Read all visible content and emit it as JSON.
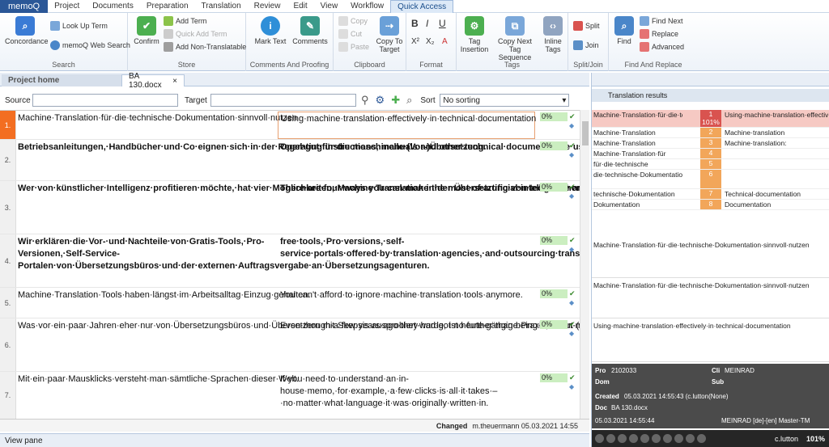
{
  "menubar": {
    "app": "memoQ",
    "tabs": [
      "Project",
      "Documents",
      "Preparation",
      "Translation",
      "Review",
      "Edit",
      "View",
      "Workflow",
      "Quick Access"
    ]
  },
  "ribbon": {
    "search": {
      "title": "Search",
      "concordance": "Concordance",
      "look_up_term": "Look Up Term",
      "web_search": "memoQ Web Search"
    },
    "store": {
      "title": "Store",
      "confirm": "Confirm",
      "add_term": "Add Term",
      "quick_add_term": "Quick Add Term",
      "add_non_translatable": "Add Non-Translatable"
    },
    "comments": {
      "title": "Comments And Proofing",
      "mark_text": "Mark Text",
      "comments": "Comments"
    },
    "clipboard": {
      "title": "Clipboard",
      "copy": "Copy",
      "cut": "Cut",
      "paste": "Paste",
      "copy_to_target": "Copy To Target"
    },
    "format": {
      "title": "Format",
      "bold": "B",
      "italic": "I",
      "underline": "U",
      "sup": "X²",
      "sub": "X₂",
      "clear": "A"
    },
    "tags": {
      "title": "Tags",
      "tag_insertion": "Tag Insertion",
      "copy_next": "Copy Next Tag Sequence",
      "inline_tags": "Inline Tags"
    },
    "splitjoin": {
      "title": "Split/Join",
      "split": "Split",
      "join": "Join"
    },
    "find": {
      "title": "Find And Replace",
      "find": "Find",
      "find_next": "Find Next",
      "replace": "Replace",
      "advanced": "Advanced"
    }
  },
  "tabs": {
    "home": "Project home",
    "doc": "BA 130.docx"
  },
  "filter": {
    "source_label": "Source",
    "target_label": "Target",
    "sort_label": "Sort",
    "sort_value": "No sorting"
  },
  "rows": [
    {
      "n": "1.",
      "src": "Machine·Translation·für·die·technische·Dokumentation·sinnvoll·nutzen",
      "tgt": "Using·machine·translation·effectively·in·technical·documentation",
      "pct": "0%",
      "bold": false
    },
    {
      "n": "2.",
      "src": "Betriebsanleitungen,·Handbücher·und·Co·eignen·sich·in·der·Regel·gut·für·die·maschinelle·(Vor-)Übersetzung.",
      "tgt": "Operating·instructions,·manuals·and·other·technical·documents·are·usually·ideal·candidates·for·machine·(pre-)translation.",
      "pct": "0%",
      "bold": true
    },
    {
      "n": "3.",
      "src": "Wer·von·künstlicher·Intelligenz·profitieren·möchte,·hat·vier·Möglichkeiten,·Machine·Translation·in·der·Übersetzung·von·technischen·Dokumentationen·einzusetzen.",
      "tgt": "There·are·four·ways·you·can·make·the·most·of·artificial·intelligence·and·use·machine·translation·(MT)·to·produce·translations·of·these·texts:",
      "pct": "0%",
      "bold": true
    },
    {
      "n": "4.",
      "src": "Wir·erklären·die·Vor-·und·Nachteile·von·Gratis-Tools,·Pro-Versionen,·Self-Service-Portalen·von·Übersetzungsbüros·und·der·externen·Auftragsvergabe·an·Übersetzungsagenturen.",
      "tgt": "free·tools,·Pro·versions,·self-service·portals·offered·by·translation·agencies,·and·outsourcing·translations·to·agencies.·We·explain·when·they·can·work·for·you,·and·when·they·might·not.",
      "pct": "0%",
      "bold": true
    },
    {
      "n": "5.",
      "src": "Machine·Translation·Tools·haben·längst·im·Arbeitsalltag·Einzug·gehalten.",
      "tgt": "You·can't·afford·to·ignore·machine·translation·tools·anymore.",
      "pct": "0%",
      "bold": false
    },
    {
      "n": "6.",
      "src": "Was·vor·ein·paar·Jahren·eher·nur·von·Übersetzungsbüros·und·Übersetzern·mit·Skepsis·ausprobiert·wurde,·ist·heute·gängige·Praxis,·wenn·man·beispielsweise·eine·interne·Korrespondenz·nachvollziehen·möchte.",
      "tgt": "Even·though·a·few·years·ago·they·had·got·no·further·than·being·tried·out·(with·considerable·scepticism)·by·agencies·and·translators,·they're·now·commonplace·at·many·businesses.",
      "pct": "0%",
      "bold": false
    },
    {
      "n": "7.",
      "src": "Mit·ein·paar·Mausklicks·versteht·man·sämtliche·Sprachen·dieser·Welt.",
      "tgt": "If·you·need·to·understand·an·in-house·memo,·for·example,·a·few·clicks·is·all·it·takes·–·no·matter·what·language·it·was·originally·written·in.",
      "pct": "0%",
      "bold": false
    }
  ],
  "status": {
    "changed_label": "Changed",
    "changed_value": "m.theuermann 05.03.2021 14:55"
  },
  "view_pane": "View pane",
  "right": {
    "title": "Translation results",
    "results": [
      {
        "src": "Machine·Translation·für·die·technische·Dokumentation·…",
        "n": "1",
        "pct": "101%",
        "tgt": "Using·machine·translation·effectively·in·technical·doc…"
      },
      {
        "src": "Machine·Translation",
        "n": "2",
        "tgt": "Machine·translation"
      },
      {
        "src": "Machine·Translation",
        "n": "3",
        "tgt": "Machine·translation:"
      },
      {
        "src": "Machine·Translation·für",
        "n": "4",
        "tgt": ""
      },
      {
        "src": "für·die·technische",
        "n": "5",
        "tgt": ""
      },
      {
        "src": "die·technische·Dokumentation",
        "n": "6",
        "tgt": ""
      },
      {
        "src": "technische·Dokumentation",
        "n": "7",
        "tgt": "Technical·documentation"
      },
      {
        "src": "Dokumentation",
        "n": "8",
        "tgt": "Documentation"
      }
    ],
    "preview1": "Machine·Translation·für·die·technische·Dokumentation·sinnvoll·nutzen",
    "preview2": "Machine·Translation·für·die·technische·Dokumentation·sinnvoll·nutzen",
    "preview3": "Using·machine·translation·effectively·in·technical·documentation",
    "meta": {
      "pro_k": "Pro",
      "pro_v": "2102033",
      "cli_k": "Cli",
      "cli_v": "MEINRAD",
      "dom_k": "Dom",
      "sub_k": "Sub",
      "created_k": "Created",
      "created_v": "05.03.2021 14:55:43 (c.lutton(None)",
      "doc_k": "Doc",
      "doc_v": "BA 130.docx",
      "date_v": "05.03.2021 14:55:44",
      "tm_v": "MEINRAD [de]-[en] Master-TM"
    },
    "bottom": {
      "user": "c.lutton",
      "zoom": "101%"
    }
  }
}
